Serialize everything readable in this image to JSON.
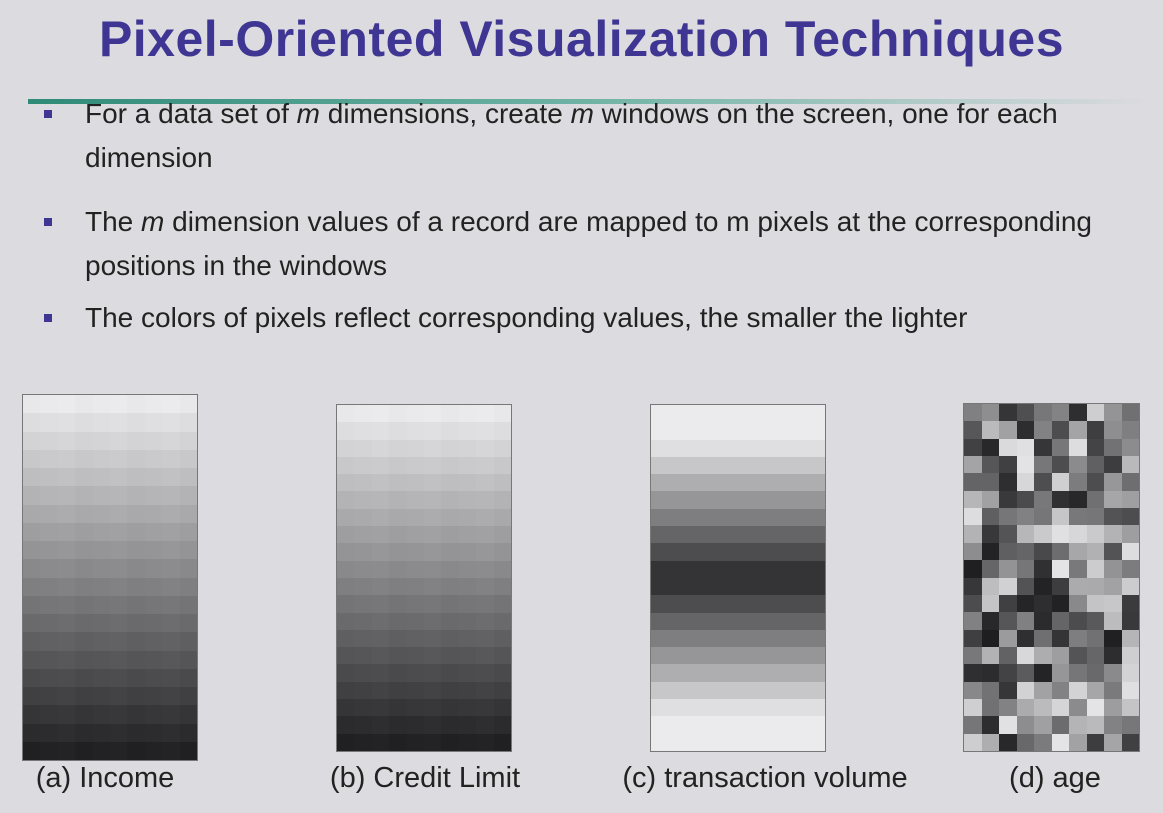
{
  "title": "Pixel-Oriented Visualization Techniques",
  "accent_color": "#3f3593",
  "bullets": [
    {
      "pre": "For a data set of ",
      "em1": "m",
      "mid": " dimensions, create ",
      "em2": "m",
      "post": " windows on the screen, one for each dimension"
    },
    {
      "pre": "The ",
      "em1": "m",
      "mid": " dimension values of a record are mapped to m pixels at the corresponding positions in the windows"
    },
    {
      "pre": "The colors of pixels reflect corresponding values, the smaller the lighter"
    }
  ],
  "panels": [
    {
      "caption": "(a)  Income",
      "pattern": "increasing"
    },
    {
      "caption": "(b) Credit Limit",
      "pattern": "increasing"
    },
    {
      "caption": "(c) transaction volume",
      "pattern": "peak-middle"
    },
    {
      "caption": "(d) age",
      "pattern": "random"
    }
  ]
}
